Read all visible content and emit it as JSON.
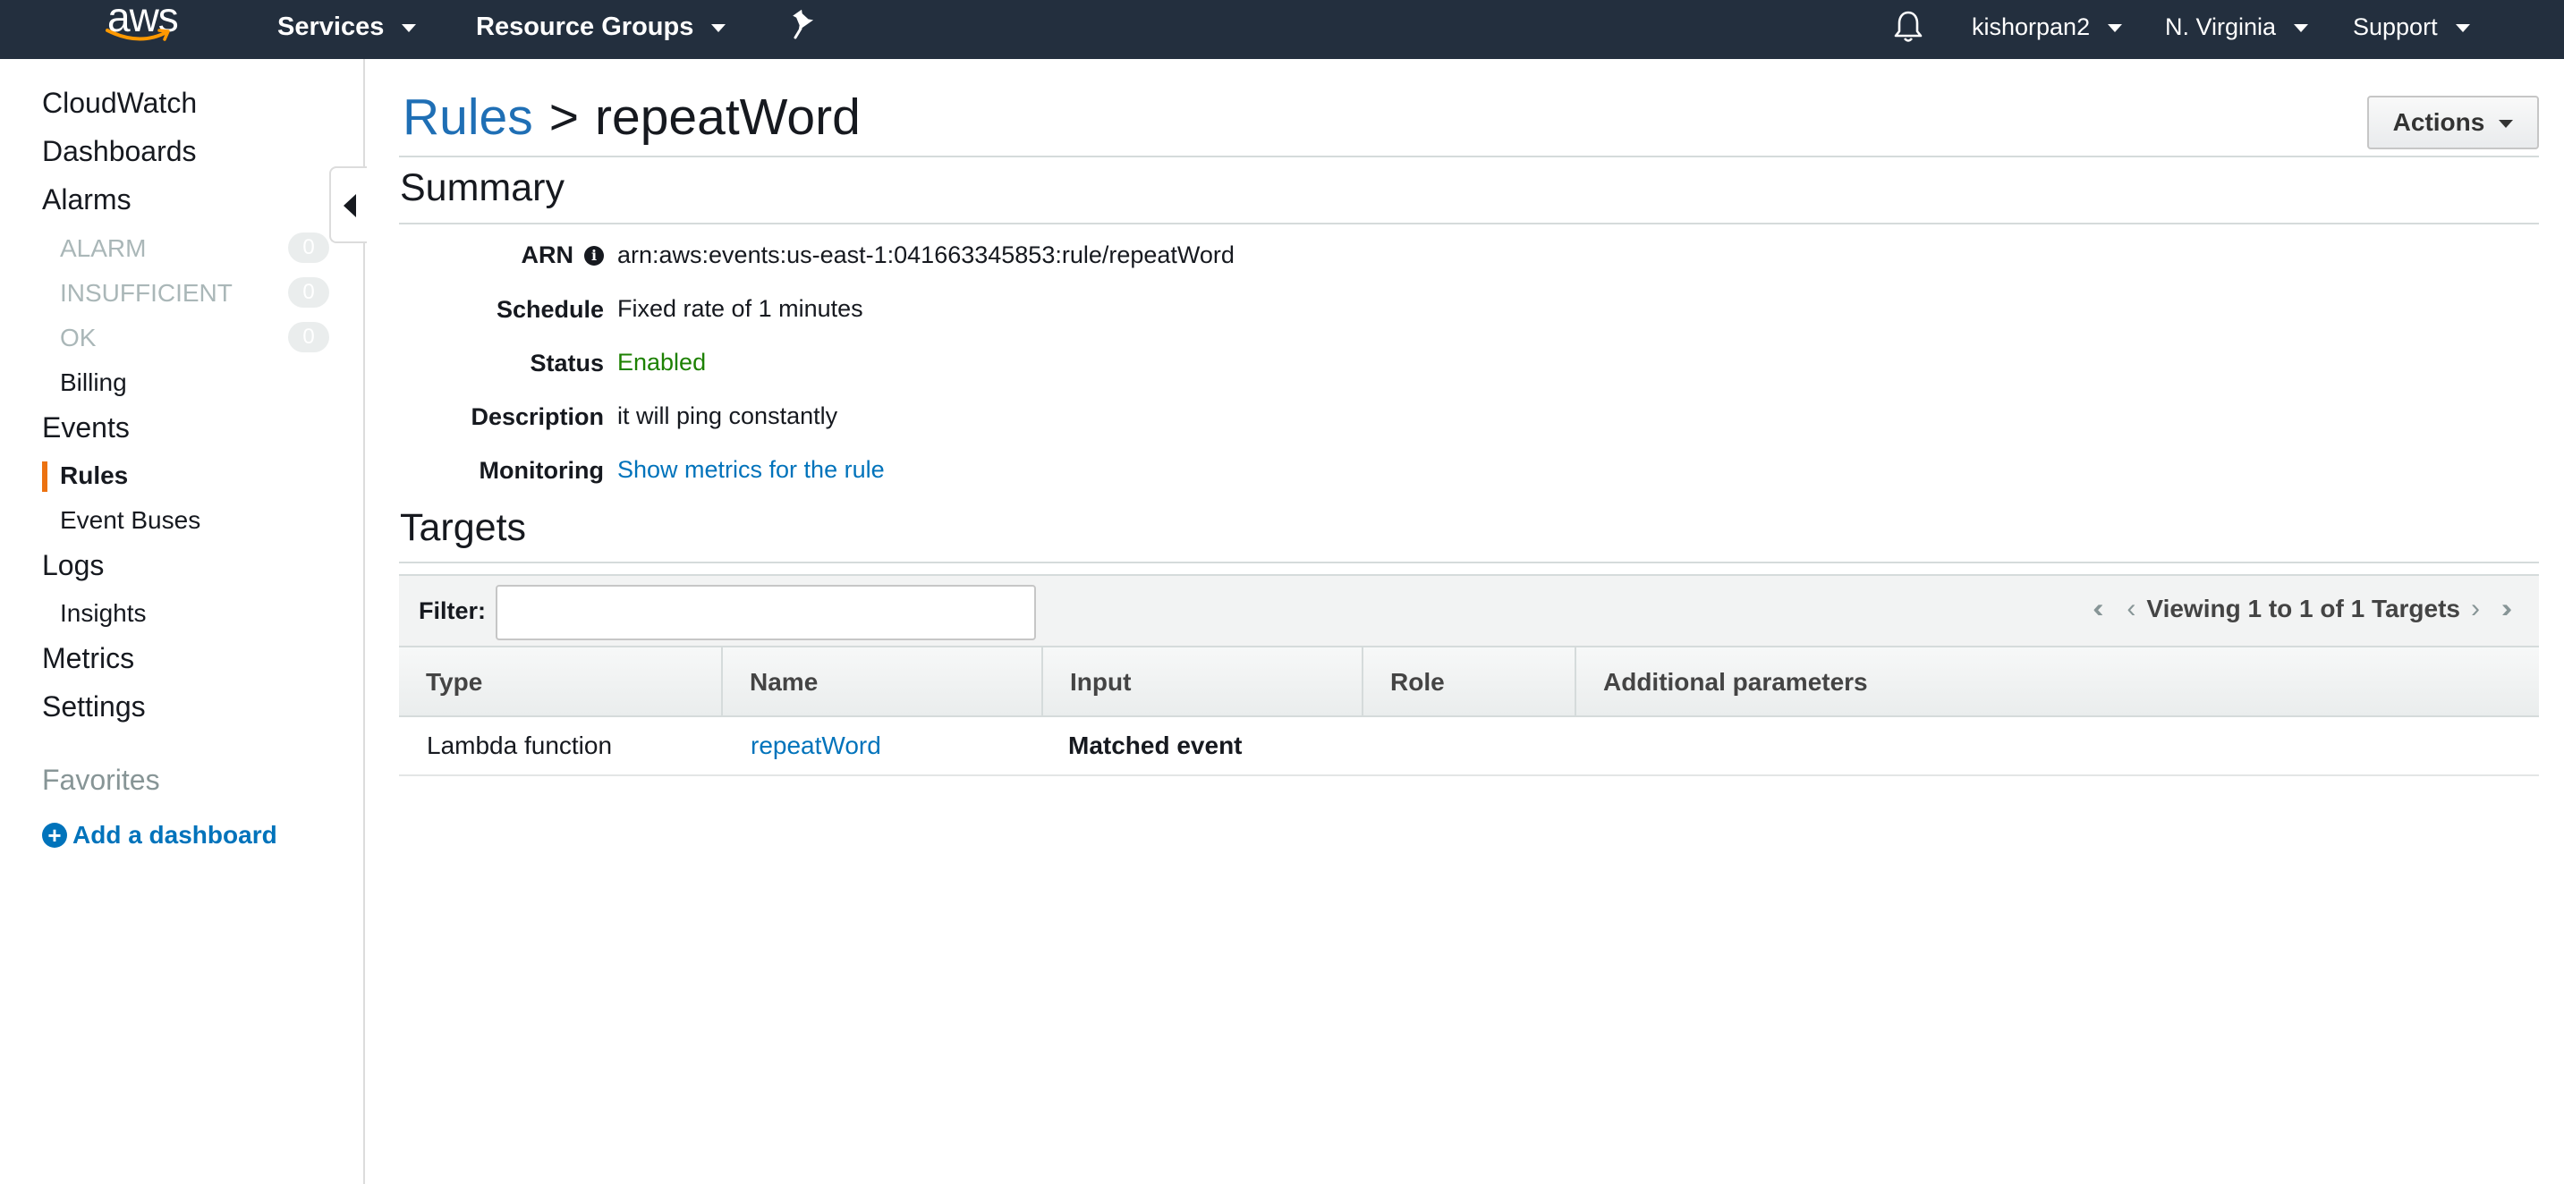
{
  "topnav": {
    "logo_text": "aws",
    "services_label": "Services",
    "resource_groups_label": "Resource Groups",
    "user_label": "kishorpan2",
    "region_label": "N. Virginia",
    "support_label": "Support"
  },
  "sidebar": {
    "cloudwatch": "CloudWatch",
    "dashboards": "Dashboards",
    "alarms": "Alarms",
    "alarm_states": [
      {
        "label": "ALARM",
        "count": "0"
      },
      {
        "label": "INSUFFICIENT",
        "count": "0"
      },
      {
        "label": "OK",
        "count": "0"
      }
    ],
    "billing": "Billing",
    "events": "Events",
    "rules": "Rules",
    "event_buses": "Event Buses",
    "logs": "Logs",
    "insights": "Insights",
    "metrics": "Metrics",
    "settings": "Settings",
    "favorites_heading": "Favorites",
    "add_dashboard": "Add a dashboard"
  },
  "header": {
    "breadcrumb_link": "Rules",
    "breadcrumb_separator": ">",
    "title": "repeatWord",
    "actions_label": "Actions"
  },
  "summary": {
    "heading": "Summary",
    "arn_label": "ARN",
    "arn_value": "arn:aws:events:us-east-1:041663345853:rule/repeatWord",
    "schedule_label": "Schedule",
    "schedule_value": "Fixed rate of 1 minutes",
    "status_label": "Status",
    "status_value": "Enabled",
    "description_label": "Description",
    "description_value": "it will ping constantly",
    "monitoring_label": "Monitoring",
    "monitoring_link": "Show metrics for the rule"
  },
  "targets": {
    "heading": "Targets",
    "filter_label": "Filter:",
    "filter_value": "",
    "pager_text": "Viewing 1 to 1 of 1 Targets",
    "columns": [
      "Type",
      "Name",
      "Input",
      "Role",
      "Additional parameters"
    ],
    "rows": [
      {
        "type": "Lambda function",
        "name": "repeatWord",
        "input": "Matched event",
        "role": "",
        "additional": ""
      }
    ]
  },
  "colors": {
    "topbar_bg": "#232f3e",
    "link": "#0073bb",
    "status_enabled": "#1d8102",
    "active_indicator": "#ec7211"
  }
}
